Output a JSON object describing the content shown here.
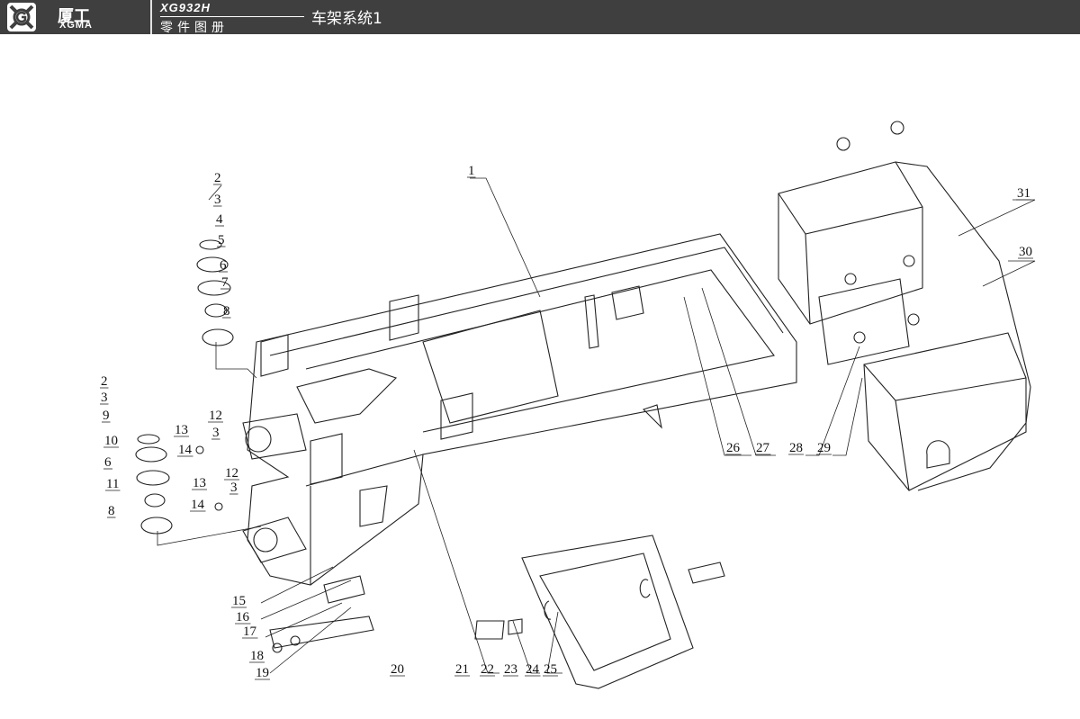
{
  "header": {
    "brand_cn": "厦工",
    "brand_en": "XGMA",
    "model_code": "XG932H",
    "book_title": "零件图册",
    "section_title": "车架系统1"
  },
  "colors": {
    "header_bg": "#3f3f3f",
    "header_text": "#ffffff",
    "line": "#222222"
  },
  "callouts": [
    "1",
    "2",
    "3",
    "4",
    "5",
    "6",
    "7",
    "8",
    "2",
    "3",
    "9",
    "10",
    "6",
    "11",
    "8",
    "12",
    "3",
    "13",
    "14",
    "12",
    "13",
    "3",
    "14",
    "15",
    "16",
    "17",
    "18",
    "19",
    "20",
    "21",
    "22",
    "23",
    "24",
    "25",
    "26",
    "27",
    "28",
    "29",
    "30",
    "31"
  ]
}
